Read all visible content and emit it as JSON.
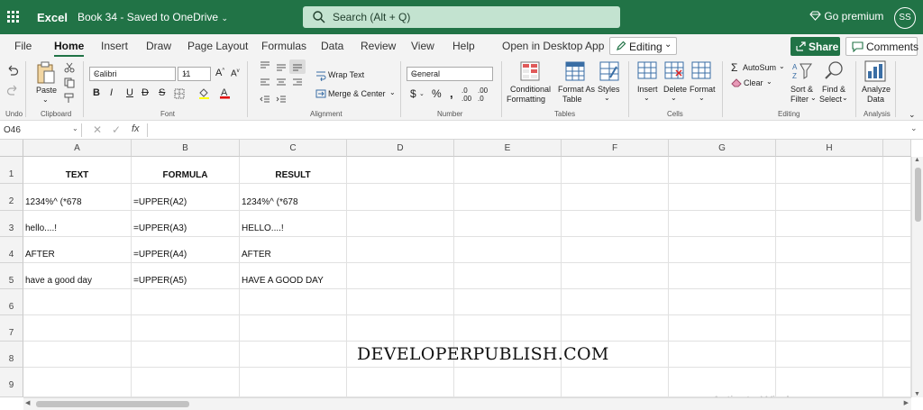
{
  "topbar": {
    "app_name": "Excel",
    "doc_title": "Book 34  -  Saved to OneDrive",
    "search_placeholder": "Search (Alt + Q)",
    "go_premium": "Go premium",
    "avatar_initials": "SS",
    "color": "#217346"
  },
  "menu": {
    "tabs": [
      "File",
      "Home",
      "Insert",
      "Draw",
      "Page Layout",
      "Formulas",
      "Data",
      "Review",
      "View",
      "Help",
      "Open in Desktop App"
    ],
    "active_tab": "Home",
    "editing_label": "Editing",
    "share_label": "Share",
    "comments_label": "Comments"
  },
  "ribbon": {
    "undo_label": "Undo",
    "clipboard": {
      "paste": "Paste",
      "group": "Clipboard"
    },
    "font": {
      "name": "Calibri",
      "size": "11",
      "group": "Font"
    },
    "alignment": {
      "wrap_text": "Wrap Text",
      "merge_center": "Merge & Center",
      "group": "Alignment"
    },
    "number": {
      "format": "General",
      "group": "Number"
    },
    "tables": {
      "conditional_formatting_1": "Conditional",
      "conditional_formatting_2": "Formatting",
      "format_as_table_1": "Format As",
      "format_as_table_2": "Table",
      "styles": "Styles",
      "group": "Tables"
    },
    "cells": {
      "insert": "Insert",
      "delete": "Delete",
      "format": "Format",
      "group": "Cells"
    },
    "editing": {
      "autosum": "AutoSum",
      "clear": "Clear",
      "sort_filter_1": "Sort &",
      "sort_filter_2": "Filter",
      "find_select_1": "Find &",
      "find_select_2": "Select",
      "group": "Editing"
    },
    "analysis": {
      "analyze_data_1": "Analyze",
      "analyze_data_2": "Data",
      "group": "Analysis"
    }
  },
  "formula_bar": {
    "name_box": "O46",
    "fx": "fx",
    "value": ""
  },
  "sheet": {
    "columns": [
      "A",
      "B",
      "C",
      "D",
      "E",
      "F",
      "G",
      "H"
    ],
    "rows": [
      "1",
      "2",
      "3",
      "4",
      "5",
      "6",
      "7",
      "8",
      "9"
    ],
    "cells": [
      [
        "TEXT",
        "FORMULA",
        "RESULT"
      ],
      [
        "1234%^  (*678",
        "=UPPER(A2)",
        "1234%^  (*678"
      ],
      [
        "hello....!",
        "=UPPER(A3)",
        "HELLO....!"
      ],
      [
        "AFTER",
        "=UPPER(A4)",
        "AFTER"
      ],
      [
        "have a good day",
        "=UPPER(A5)",
        "HAVE A GOOD DAY"
      ]
    ]
  },
  "overlay": {
    "watermark": "DEVELOPERPUBLISH.COM",
    "activate_windows": "Activate Windows"
  }
}
